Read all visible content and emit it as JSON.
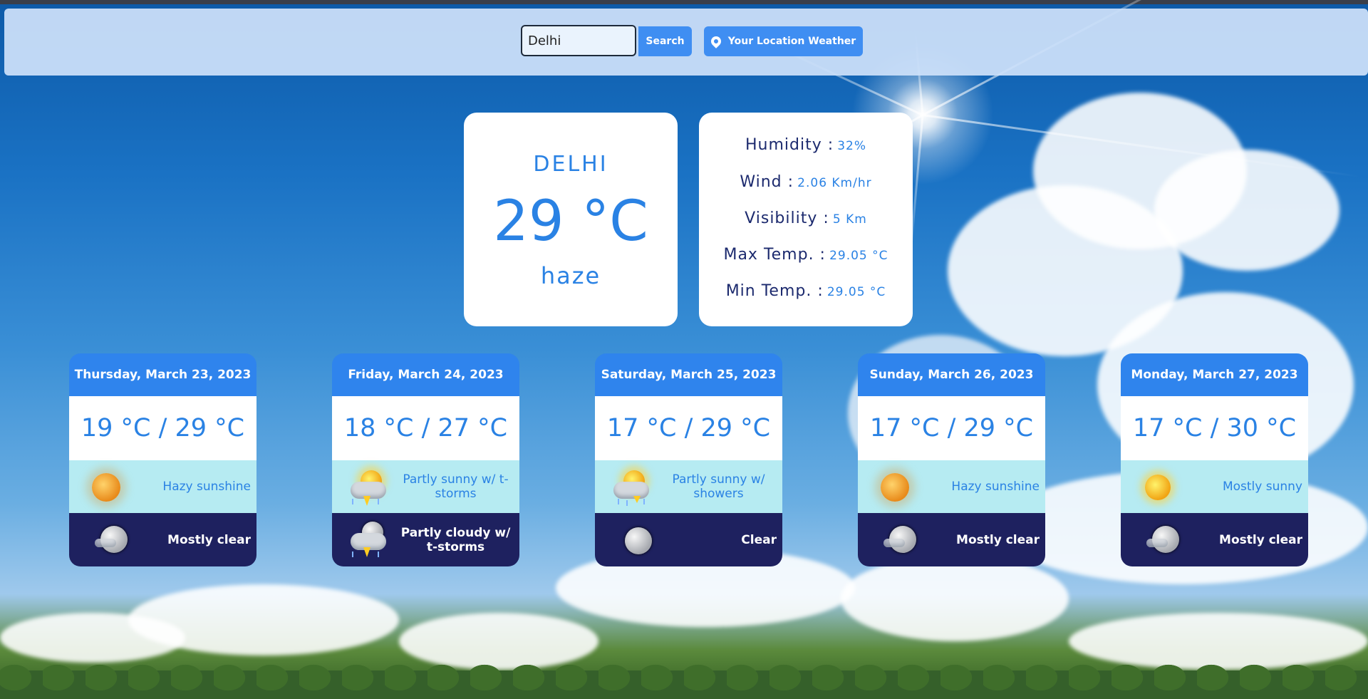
{
  "search": {
    "value": "Delhi",
    "button_label": "Search",
    "location_button_label": "Your Location Weather"
  },
  "current": {
    "city": "DELHI",
    "temperature": "29 °C",
    "condition": "haze"
  },
  "details": [
    {
      "label": "Humidity :",
      "value": "32%"
    },
    {
      "label": "Wind :",
      "value": "2.06 Km/hr"
    },
    {
      "label": "Visibility :",
      "value": "5 Km"
    },
    {
      "label": "Max Temp. :",
      "value": "29.05 °C"
    },
    {
      "label": "Min Temp. :",
      "value": "29.05 °C"
    }
  ],
  "forecast": [
    {
      "date": "Thursday, March 23, 2023",
      "temps": "19 °C / 29 °C",
      "day_icon": "hazy-sun-icon",
      "day_text": "Hazy sunshine",
      "night_icon": "mostly-clear-moon-icon",
      "night_text": "Mostly clear"
    },
    {
      "date": "Friday, March 24, 2023",
      "temps": "18 °C / 27 °C",
      "day_icon": "partly-sunny-tstorm-icon",
      "day_text": "Partly sunny w/ t-storms",
      "night_icon": "partly-cloudy-tstorm-icon",
      "night_text": "Partly cloudy w/ t-storms"
    },
    {
      "date": "Saturday, March 25, 2023",
      "temps": "17 °C / 29 °C",
      "day_icon": "partly-sunny-showers-icon",
      "day_text": "Partly sunny w/ showers",
      "night_icon": "clear-moon-icon",
      "night_text": "Clear"
    },
    {
      "date": "Sunday, March 26, 2023",
      "temps": "17 °C / 29 °C",
      "day_icon": "hazy-sun-icon",
      "day_text": "Hazy sunshine",
      "night_icon": "mostly-clear-moon-icon",
      "night_text": "Mostly clear"
    },
    {
      "date": "Monday, March 27, 2023",
      "temps": "17 °C / 30 °C",
      "day_icon": "mostly-sunny-icon",
      "day_text": "Mostly sunny",
      "night_icon": "mostly-clear-moon-icon",
      "night_text": "Mostly clear"
    }
  ],
  "colors": {
    "accent": "#2f84ed",
    "text_blue": "#2a82e4",
    "label_navy": "#1c2a6e",
    "day_band": "#b6ebf2",
    "night_band": "#1e215f"
  }
}
